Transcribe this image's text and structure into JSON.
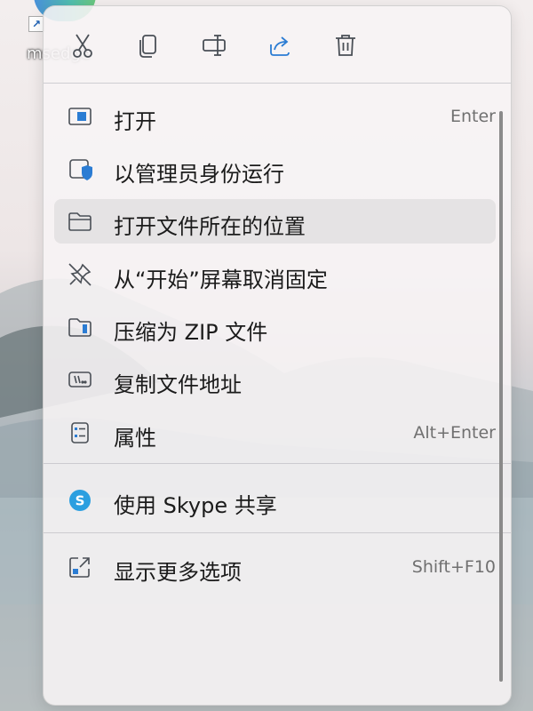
{
  "desktop": {
    "shortcut_label": "msedge"
  },
  "toolbar": {
    "buttons": [
      {
        "icon": "scissors-icon",
        "tooltip": "cut"
      },
      {
        "icon": "copy-icon",
        "tooltip": "copy"
      },
      {
        "icon": "rename-icon",
        "tooltip": "rename"
      },
      {
        "icon": "share-icon",
        "tooltip": "share"
      },
      {
        "icon": "trash-icon",
        "tooltip": "delete"
      }
    ]
  },
  "menu": {
    "items": [
      {
        "label": "打开",
        "shortcut": "Enter",
        "icon": "open-app-icon"
      },
      {
        "label": "以管理员身份运行",
        "shortcut": "",
        "icon": "admin-shield-icon"
      },
      {
        "label": "打开文件所在的位置",
        "shortcut": "",
        "icon": "folder-icon",
        "highlighted": true
      },
      {
        "label": "从“开始”屏幕取消固定",
        "shortcut": "",
        "icon": "unpin-icon"
      },
      {
        "label": "压缩为 ZIP 文件",
        "shortcut": "",
        "icon": "zip-icon"
      },
      {
        "label": "复制文件地址",
        "shortcut": "",
        "icon": "copy-path-icon"
      },
      {
        "label": "属性",
        "shortcut": "Alt+Enter",
        "icon": "properties-icon"
      }
    ],
    "share_item": {
      "label": "使用 Skype 共享",
      "icon": "skype-icon"
    },
    "more_item": {
      "label": "显示更多选项",
      "shortcut": "Shift+F10",
      "icon": "more-options-icon"
    }
  },
  "colors": {
    "menu_background": "#f7f4f5",
    "icon_stroke": "#4a4f56",
    "accent_blue": "#2b7cd3",
    "shortcut_gray": "#707070"
  }
}
